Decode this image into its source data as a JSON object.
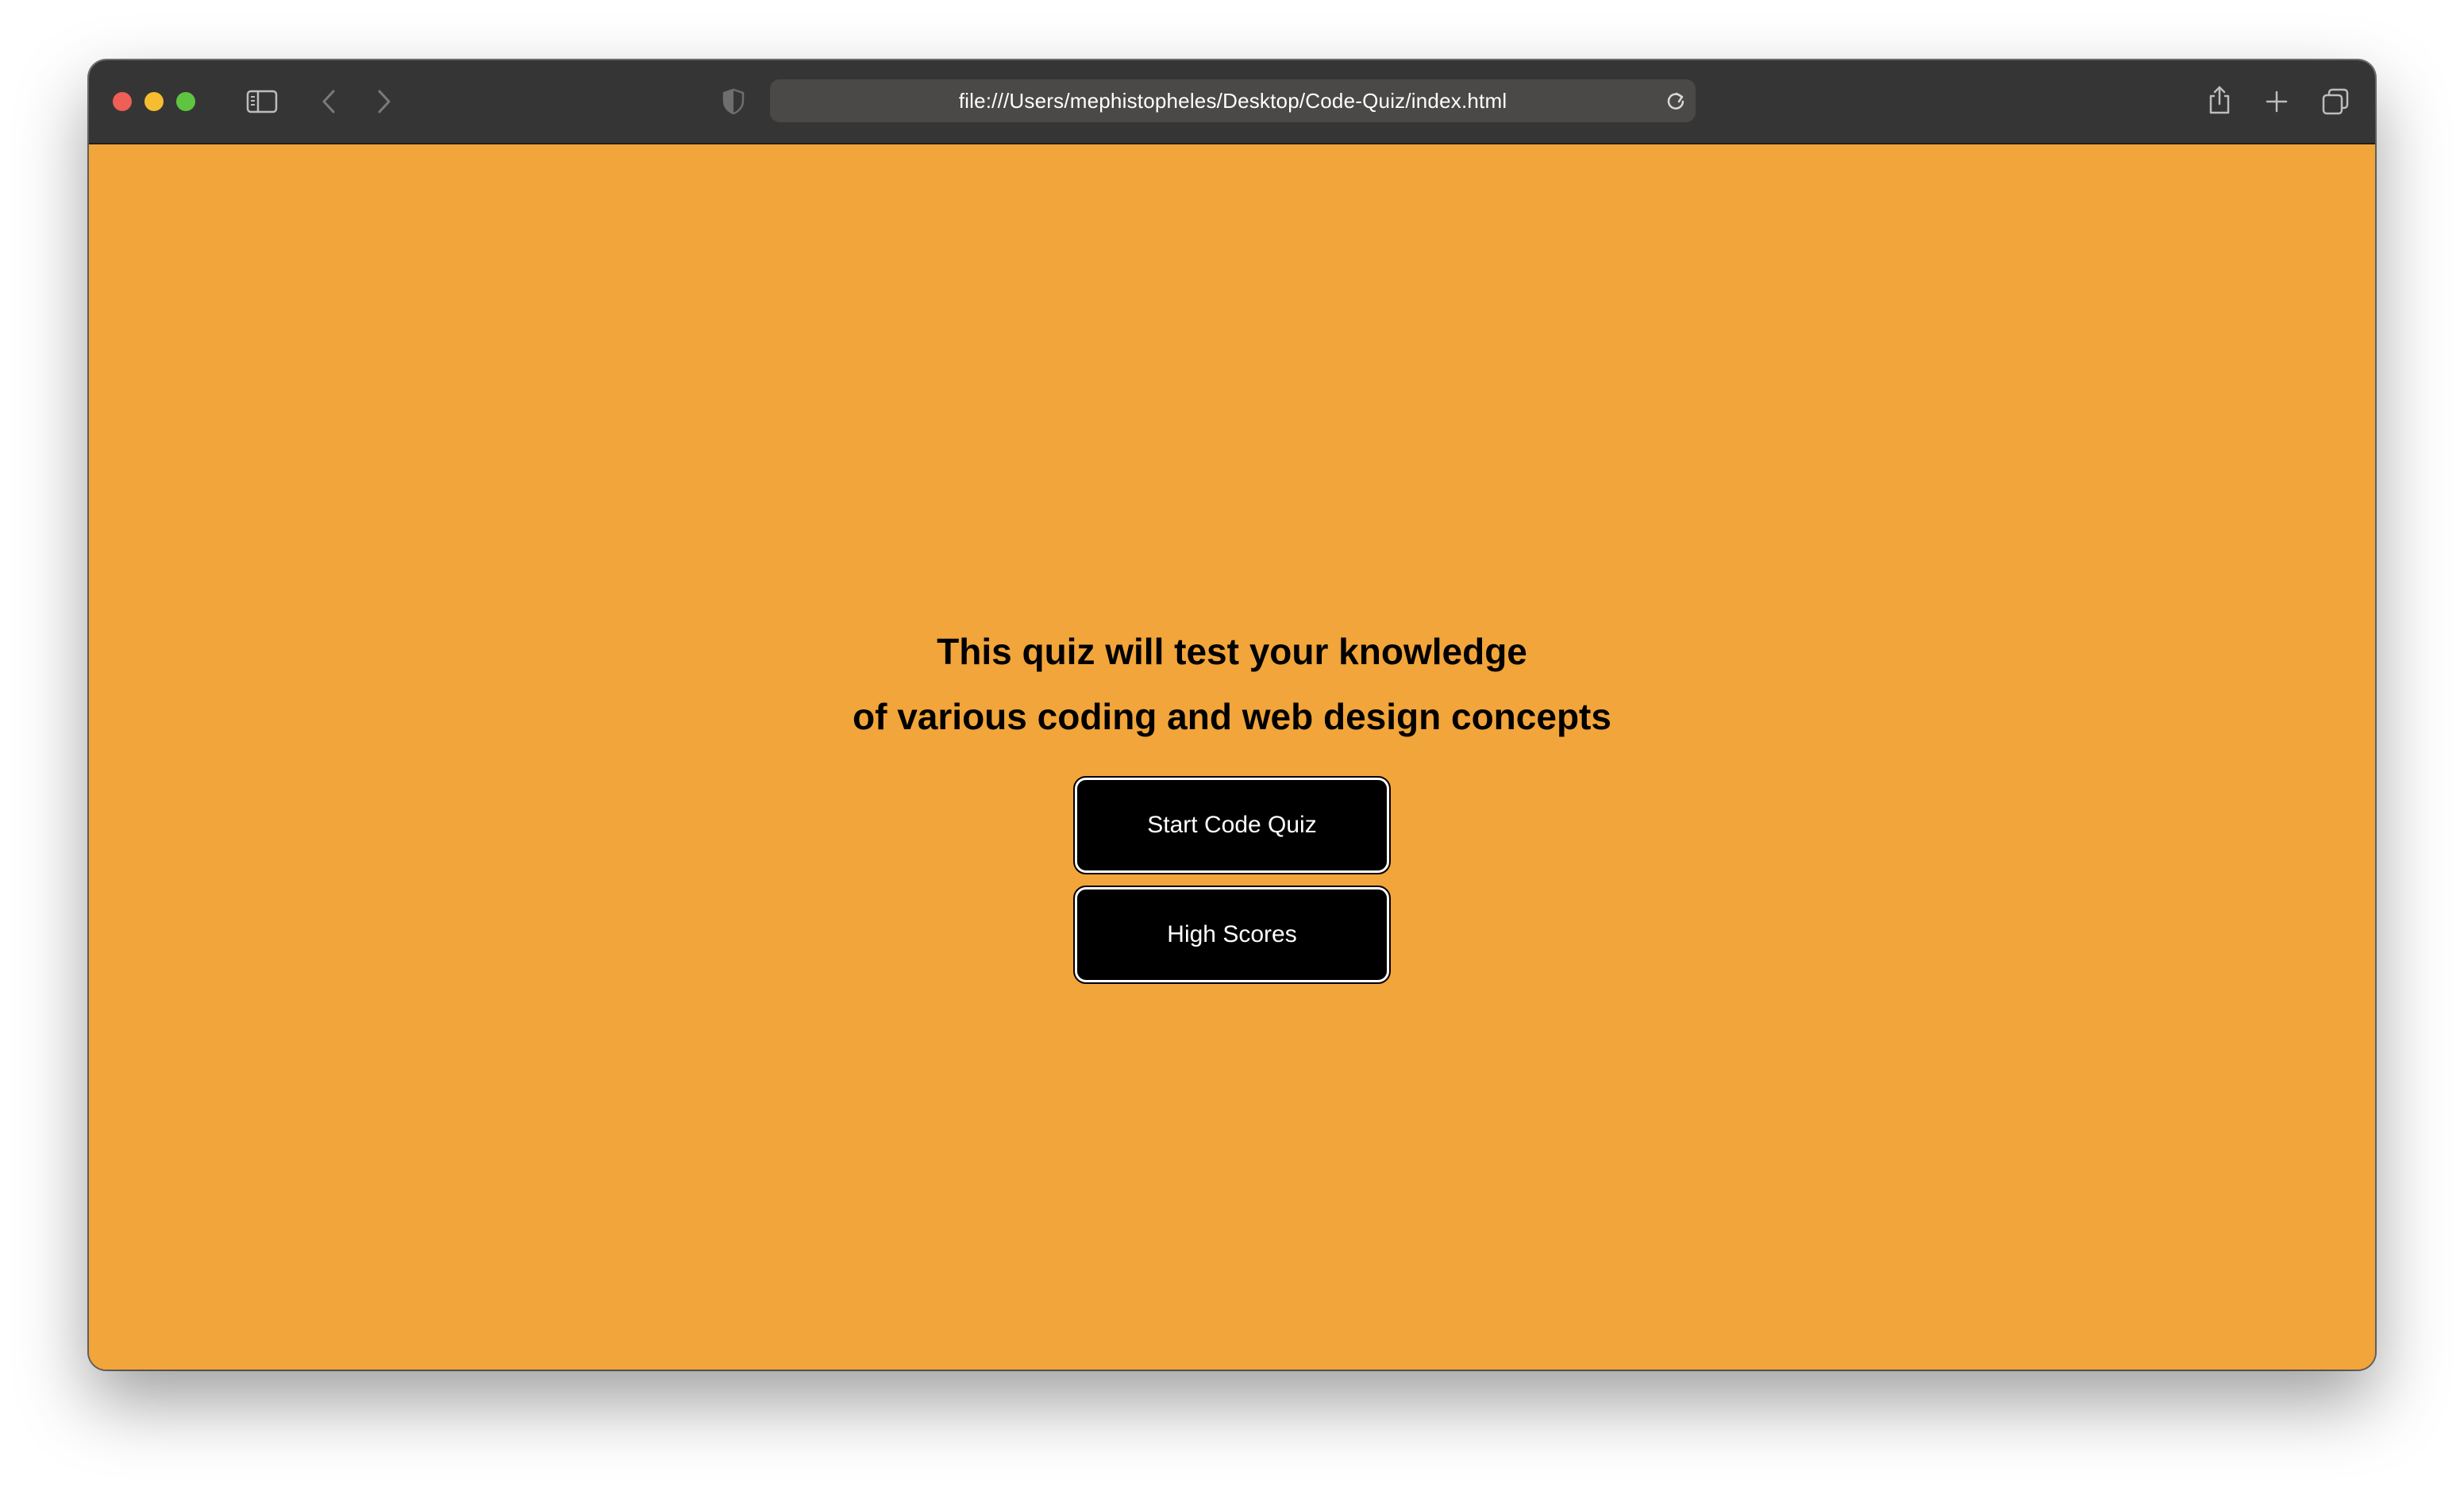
{
  "browser": {
    "url": "file:///Users/mephistopheles/Desktop/Code-Quiz/index.html",
    "traffic_lights": {
      "close_color": "#ee5f57",
      "minimize_color": "#f5bd2f",
      "maximize_color": "#5fc540"
    },
    "toolbar_color": "#363535",
    "icons": [
      "sidebar-icon",
      "back-icon",
      "forward-icon",
      "privacy-shield-icon",
      "reload-icon",
      "share-icon",
      "new-tab-icon",
      "tab-overview-icon"
    ]
  },
  "page": {
    "background_color": "#f2a53a",
    "intro_line_1": "This quiz will test your knowledge",
    "intro_line_2": "of various coding and web design concepts",
    "start_button_label": "Start Code Quiz",
    "high_scores_button_label": "High Scores"
  }
}
